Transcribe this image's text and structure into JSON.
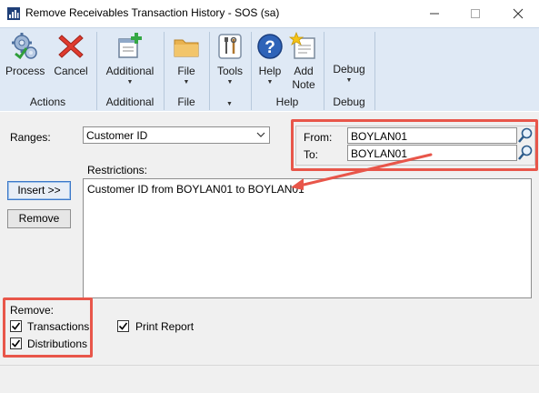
{
  "window": {
    "title": "Remove Receivables Transaction History  -  SOS (sa)"
  },
  "ribbon": {
    "process": "Process",
    "cancel": "Cancel",
    "additional": "Additional",
    "file": "File",
    "tools": "Tools",
    "help": "Help",
    "add_note_line1": "Add",
    "add_note_line2": "Note",
    "debug": "Debug",
    "groups": {
      "actions": "Actions",
      "additional": "Additional",
      "file": "File",
      "tools": "",
      "help": "Help",
      "debug": "Debug"
    }
  },
  "form": {
    "ranges_label": "Ranges:",
    "ranges_value": "Customer ID",
    "from_label": "From:",
    "from_value": "BOYLAN01",
    "to_label": "To:",
    "to_value": "BOYLAN01",
    "restrictions_label": "Restrictions:",
    "restrictions": [
      "Customer ID from BOYLAN01 to BOYLAN01"
    ],
    "insert_button": "Insert >>",
    "remove_button": "Remove",
    "remove_label": "Remove:",
    "transactions_label": "Transactions",
    "transactions_checked": true,
    "distributions_label": "Distributions",
    "distributions_checked": true,
    "print_report_label": "Print Report",
    "print_report_checked": true
  },
  "colors": {
    "highlight": "#e8564a",
    "ribbon_bg": "#dfe9f5"
  }
}
